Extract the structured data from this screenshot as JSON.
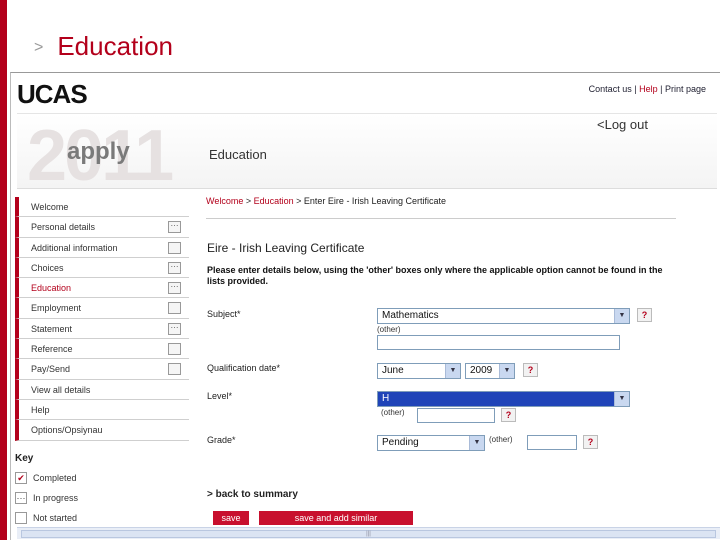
{
  "slide": {
    "chevron": ">",
    "title": "Education"
  },
  "header": {
    "logo": "UCAS",
    "links": {
      "contact": "Contact us",
      "sep1": "|",
      "help": "Help",
      "sep2": "|",
      "print": "Print page"
    },
    "year": "2011",
    "apply": "apply",
    "section_heading": "Education",
    "logout": "<Log out"
  },
  "breadcrumb": {
    "welcome": "Welcome",
    "sep1": " > ",
    "education": "Education",
    "sep2": " > ",
    "current": "Enter Eire - Irish Leaving Certificate"
  },
  "nav": {
    "items": [
      {
        "label": "Welcome",
        "status": ""
      },
      {
        "label": "Personal details",
        "status": "···"
      },
      {
        "label": "Additional information",
        "status": ""
      },
      {
        "label": "Choices",
        "status": "···"
      },
      {
        "label": "Education",
        "status": "···",
        "current": true
      },
      {
        "label": "Employment",
        "status": ""
      },
      {
        "label": "Statement",
        "status": "···"
      },
      {
        "label": "Reference",
        "status": ""
      },
      {
        "label": "Pay/Send",
        "status": ""
      },
      {
        "label": "View all details",
        "status": ""
      },
      {
        "label": "Help",
        "status": ""
      },
      {
        "label": "Options/Opsiynau",
        "status": ""
      }
    ]
  },
  "key": {
    "title": "Key",
    "items": [
      {
        "label": "Completed",
        "mark": "✔"
      },
      {
        "label": "In progress",
        "mark": "···"
      },
      {
        "label": "Not started",
        "mark": ""
      }
    ]
  },
  "form": {
    "title": "Eire - Irish Leaving Certificate",
    "note": "Please enter details below, using the 'other' boxes only where the applicable option cannot be found in the lists provided.",
    "subject": {
      "label": "Subject*",
      "value": "Mathematics",
      "other_label": "(other)"
    },
    "qualification_date": {
      "label": "Qualification date*",
      "month": "June",
      "year": "2009"
    },
    "level": {
      "label": "Level*",
      "value": "H",
      "other_label": "(other)"
    },
    "grade": {
      "label": "Grade*",
      "value": "Pending",
      "other_label": "(other)"
    },
    "help_glyph": "?"
  },
  "actions": {
    "back": "> back to summary",
    "save": "save",
    "save_add": "save and add similar"
  },
  "scroll": {
    "grip": "|||"
  },
  "colors": {
    "accent": "#b3001b",
    "button": "#c8102e",
    "highlight": "#1f44b8"
  }
}
